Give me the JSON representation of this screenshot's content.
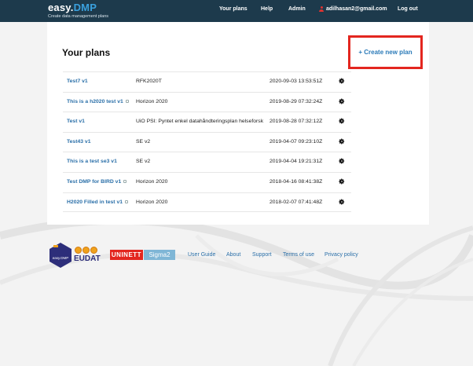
{
  "app": {
    "name_main": "easy.",
    "name_accent": "DMP",
    "tagline": "Create data management plans"
  },
  "nav": {
    "plans": "Your plans",
    "help": "Help",
    "admin": "Admin",
    "user": "adilhasan2@gmail.com",
    "logout": "Log out"
  },
  "main": {
    "title": "Your plans",
    "create_button": "+ Create new plan"
  },
  "plans": [
    {
      "name": "Test7 v1",
      "template": "RFK2020T",
      "date": "2020-09-03 13:53:51Z",
      "locked": false
    },
    {
      "name": "This is a h2020 test v1",
      "template": "Horizon 2020",
      "date": "2019-08-29 07:32:24Z",
      "locked": true
    },
    {
      "name": "Test v1",
      "template": "UiO PSI: Pyntet enkel datahåndteringsplan helseforsk",
      "date": "2019-08-28 07:32:12Z",
      "locked": false
    },
    {
      "name": "Test43 v1",
      "template": "SE v2",
      "date": "2019-04-07 09:23:10Z",
      "locked": false
    },
    {
      "name": "This is a test se3 v1",
      "template": "SE v2",
      "date": "2019-04-04 19:21:31Z",
      "locked": false
    },
    {
      "name": "Test DMP for BIRD v1",
      "template": "Horizon 2020",
      "date": "2018-04-16 08:41:38Z",
      "locked": true
    },
    {
      "name": "H2020 Filled in test v1",
      "template": "Horizon 2020",
      "date": "2018-02-07 07:41:48Z",
      "locked": true
    }
  ],
  "footer": {
    "eudat_text": "EUDAT",
    "eudat_badge": "easy.DMP",
    "unit_logo": "UNINETT",
    "sigma_logo": "Sigma2",
    "links": {
      "guide": "User Guide",
      "about": "About",
      "support": "Support",
      "terms": "Terms of use",
      "privacy": "Privacy policy"
    }
  },
  "colors": {
    "topbar": "#1d3a4c",
    "accent": "#3aa0dd",
    "link": "#2a6fa8",
    "highlight_box": "#e3261f"
  }
}
